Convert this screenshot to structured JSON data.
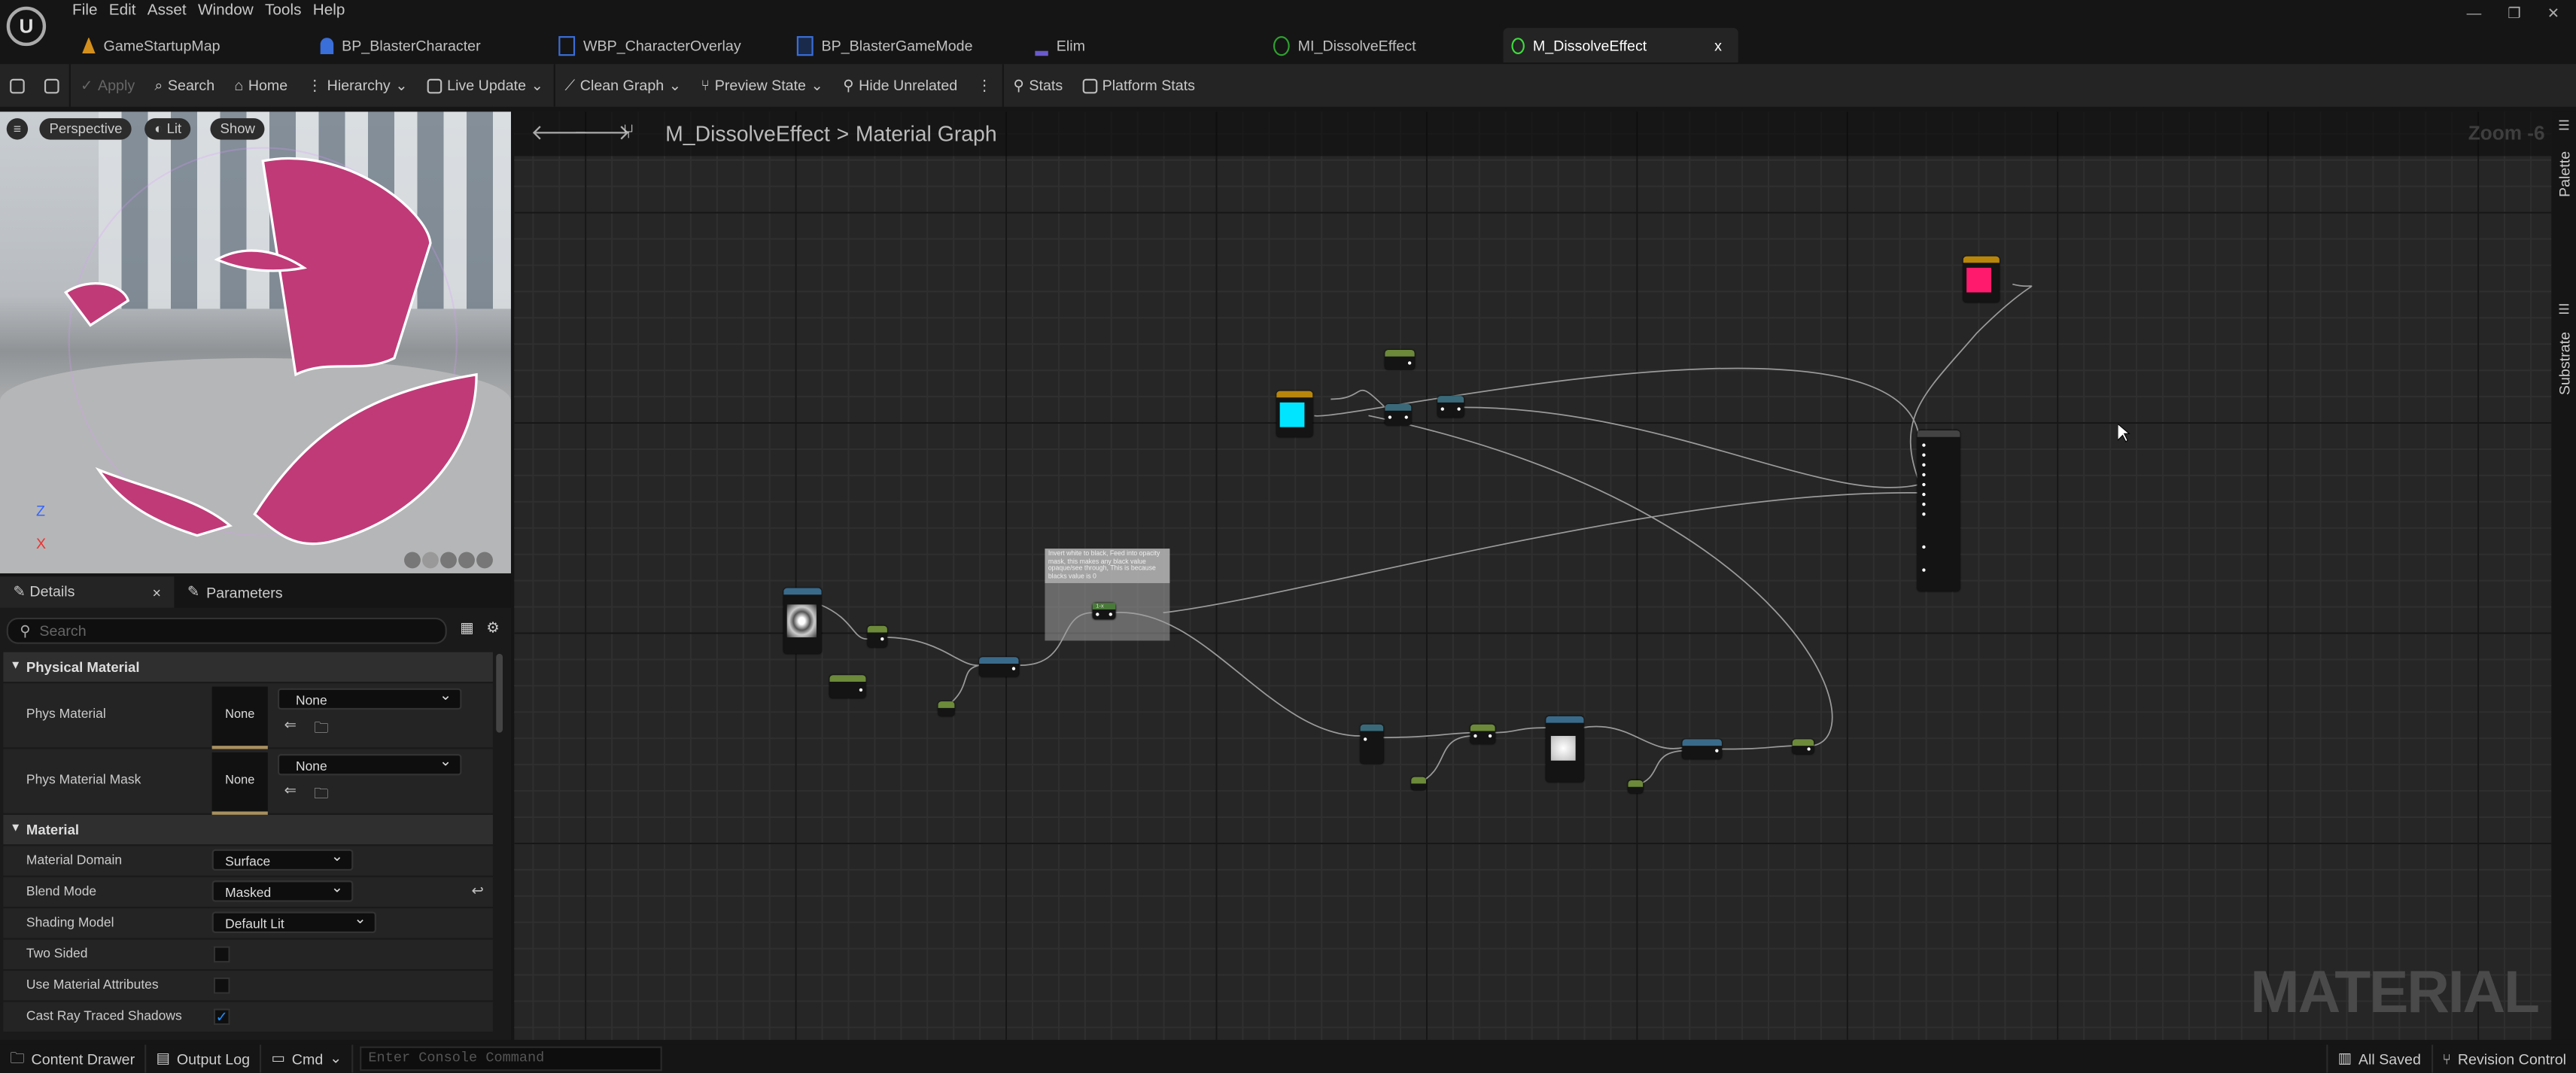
{
  "menu": [
    "File",
    "Edit",
    "Asset",
    "Window",
    "Tools",
    "Help"
  ],
  "tabs": [
    {
      "label": "GameStartupMap",
      "color": "#d4901c"
    },
    {
      "label": "BP_BlasterCharacter",
      "color": "#3a6ed8"
    },
    {
      "label": "WBP_CharacterOverlay",
      "color": "#3a6ed8"
    },
    {
      "label": "BP_BlasterGameMode",
      "color": "#3a6ed8"
    },
    {
      "label": "Elim",
      "color": "#6a5acd"
    },
    {
      "label": "MI_DissolveEffect",
      "color": "#2fa02f"
    },
    {
      "label": "M_DissolveEffect",
      "color": "#3ddc3d",
      "close": "x"
    }
  ],
  "toolbar": {
    "apply": "Apply",
    "search": "Search",
    "home": "Home",
    "hierarchy": "Hierarchy",
    "live_update": "Live Update",
    "clean_graph": "Clean Graph",
    "preview_state": "Preview State",
    "hide_unrelated": "Hide Unrelated",
    "stats": "Stats",
    "platform_stats": "Platform Stats"
  },
  "viewport": {
    "perspective": "Perspective",
    "lit": "Lit",
    "show": "Show",
    "axis_z": "Z",
    "axis_x": "X"
  },
  "details": {
    "tab_details": "Details",
    "tab_close": "×",
    "tab_parameters": "Parameters",
    "search_placeholder": "Search",
    "cat_physical": "Physical Material",
    "phys_material": "Phys Material",
    "phys_material_mask": "Phys Material Mask",
    "none": "None",
    "cat_material": "Material",
    "material_domain": "Material Domain",
    "material_domain_value": "Surface",
    "blend_mode": "Blend Mode",
    "blend_mode_value": "Masked",
    "shading_model": "Shading Model",
    "shading_model_value": "Default Lit",
    "two_sided": "Two Sided",
    "use_material_attributes": "Use Material Attributes",
    "cast_ray_traced_shadows": "Cast Ray Traced Shadows",
    "two_sided_checked": false,
    "use_material_attributes_checked": false,
    "cast_ray_traced_shadows_checked": true
  },
  "graph": {
    "breadcrumb_asset": "M_DissolveEffect",
    "breadcrumb_sep": ">",
    "breadcrumb_graph": "Material Graph",
    "zoom": "Zoom -6",
    "watermark": "MATERIAL",
    "comment": "Invert white to black, Feed into opacity mask, this makes any black value opaque/see through, This is because blacks value is 0",
    "oneminus_label": "1-x",
    "colors": {
      "emissive_constant": "#ff1a6e",
      "cyan_constant": "#00e5ff"
    }
  },
  "right_sidebar": {
    "palette": "Palette",
    "substrate": "Substrate"
  },
  "status": {
    "content_drawer": "Content Drawer",
    "output_log": "Output Log",
    "cmd": "Cmd",
    "console_placeholder": "Enter Console Command",
    "all_saved": "All Saved",
    "revision_control": "Revision Control"
  }
}
